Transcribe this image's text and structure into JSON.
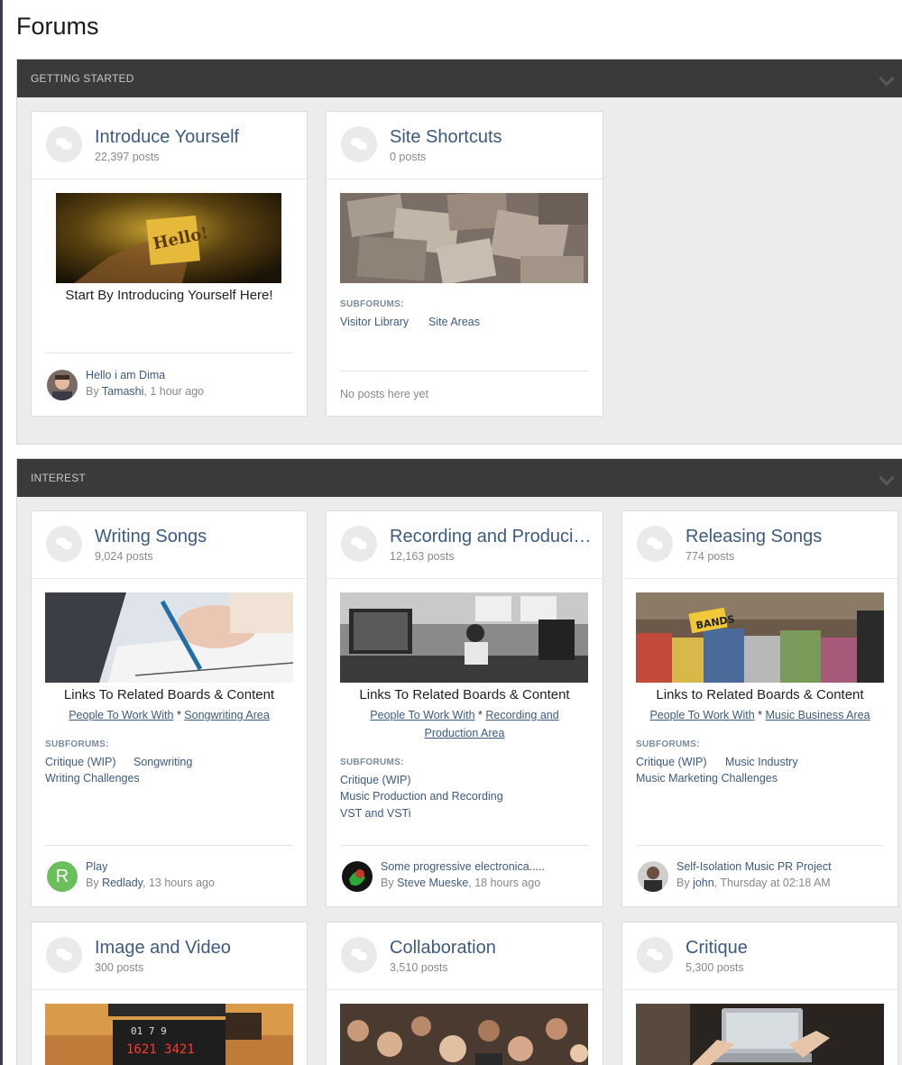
{
  "page": {
    "title": "Forums"
  },
  "sections": [
    {
      "name": "GETTING STARTED"
    },
    {
      "name": "INTEREST"
    }
  ],
  "forums": {
    "introduce": {
      "title": "Introduce Yourself",
      "posts": "22,397 posts",
      "description": "Start By Introducing Yourself Here!",
      "last_title": "Hello i am Dima",
      "last_by": "By ",
      "last_author": "Tamashi",
      "last_time": ", 1 hour ago"
    },
    "shortcuts": {
      "title": "Site Shortcuts",
      "posts": "0 posts",
      "subforums_label": "SUBFORUMS:",
      "subforums": [
        "Visitor Library",
        "Site Areas"
      ],
      "empty": "No posts here yet"
    },
    "writing": {
      "title": "Writing Songs",
      "posts": "9,024 posts",
      "description": "Links To Related Boards & Content",
      "link1": "People To Work With",
      "sep": " * ",
      "link2": "Songwriting Area",
      "subforums_label": "SUBFORUMS:",
      "subforums": [
        "Critique (WIP)",
        "Songwriting",
        "Writing Challenges"
      ],
      "avatar_letter": "R",
      "last_title": "Play",
      "last_by": "By ",
      "last_author": "Redlady",
      "last_time": ", 13 hours ago"
    },
    "recording": {
      "title": "Recording and Producing",
      "posts": "12,163 posts",
      "description": "Links To Related Boards & Content",
      "link1": "People To Work With",
      "sep": " * ",
      "link2": "Recording and Production Area",
      "subforums_label": "SUBFORUMS:",
      "subforums": [
        "Critique (WIP)",
        "Music Production and Recording",
        "VST and VSTi"
      ],
      "last_title": "Some progressive electronica.....",
      "last_by": "By ",
      "last_author": "Steve Mueske",
      "last_time": ", 18 hours ago"
    },
    "releasing": {
      "title": "Releasing Songs",
      "posts": "774 posts",
      "description": "Links to Related Boards & Content",
      "link1": "People To Work With",
      "sep": " * ",
      "link2": "Music Business Area",
      "subforums_label": "SUBFORUMS:",
      "subforums": [
        "Critique (WIP)",
        "Music Industry",
        "Music Marketing Challenges"
      ],
      "last_title": "Self-Isolation Music PR Project",
      "last_by": "By ",
      "last_author": "john",
      "last_time": ", Thursday at 02:18 AM"
    },
    "image": {
      "title": "Image and Video",
      "posts": "300 posts",
      "clapper": "1621 3421",
      "clapper_top": "01  7  9"
    },
    "collab": {
      "title": "Collaboration",
      "posts": "3,510 posts"
    },
    "critique": {
      "title": "Critique",
      "posts": "5,300 posts"
    }
  },
  "hello_sign": "Hello!",
  "band_sign": "BANDS",
  "colors": {
    "link": "#3d5a80",
    "header_bar": "#3a3a3a",
    "section_bg": "#ececec",
    "avatar_green": "#6abf5a"
  }
}
